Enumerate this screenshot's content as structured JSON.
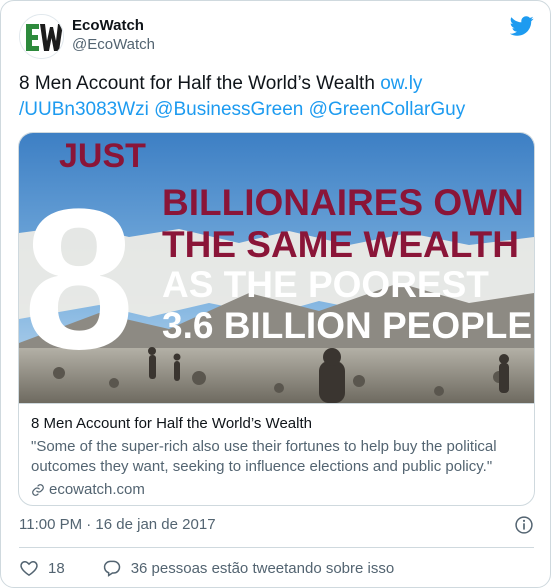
{
  "account": {
    "name": "EcoWatch",
    "handle": "@EcoWatch",
    "avatar_text": "EW"
  },
  "tweet": {
    "text_plain": "8 Men Account for Half the World’s Wealth ",
    "link1": "ow.ly\n/UUBn3083Wzi",
    "link1_line1": "ow.ly",
    "link1_line2": "/UUBn3083Wzi",
    "mention1": "@BusinessGreen",
    "mention2": "@GreenCollarGuy"
  },
  "card": {
    "image_text": {
      "just": "JUST",
      "number": "8",
      "line1": "BILLIONAIRES OWN",
      "line2": "THE SAME WEALTH",
      "line3": "AS THE POOREST",
      "line4": "3.6 BILLION PEOPLE"
    },
    "title": "8 Men Account for Half the World’s Wealth",
    "description": "\"Some of the super-rich also use their fortunes to help buy the political outcomes they want, seeking to influence elections and public policy.\"",
    "domain": "ecowatch.com"
  },
  "meta": {
    "timestamp": "11:00 PM · 16 de jan de 2017"
  },
  "footer": {
    "likes": "18",
    "discussion": "36 pessoas estão tweetando sobre isso"
  },
  "colors": {
    "brand_blue": "#1d9bf0",
    "maroon": "#8a1538",
    "logo_green": "#2d8a3c"
  },
  "icons": [
    "twitter-bird-icon",
    "link-icon",
    "info-icon",
    "heart-icon",
    "chat-bubble-icon"
  ]
}
